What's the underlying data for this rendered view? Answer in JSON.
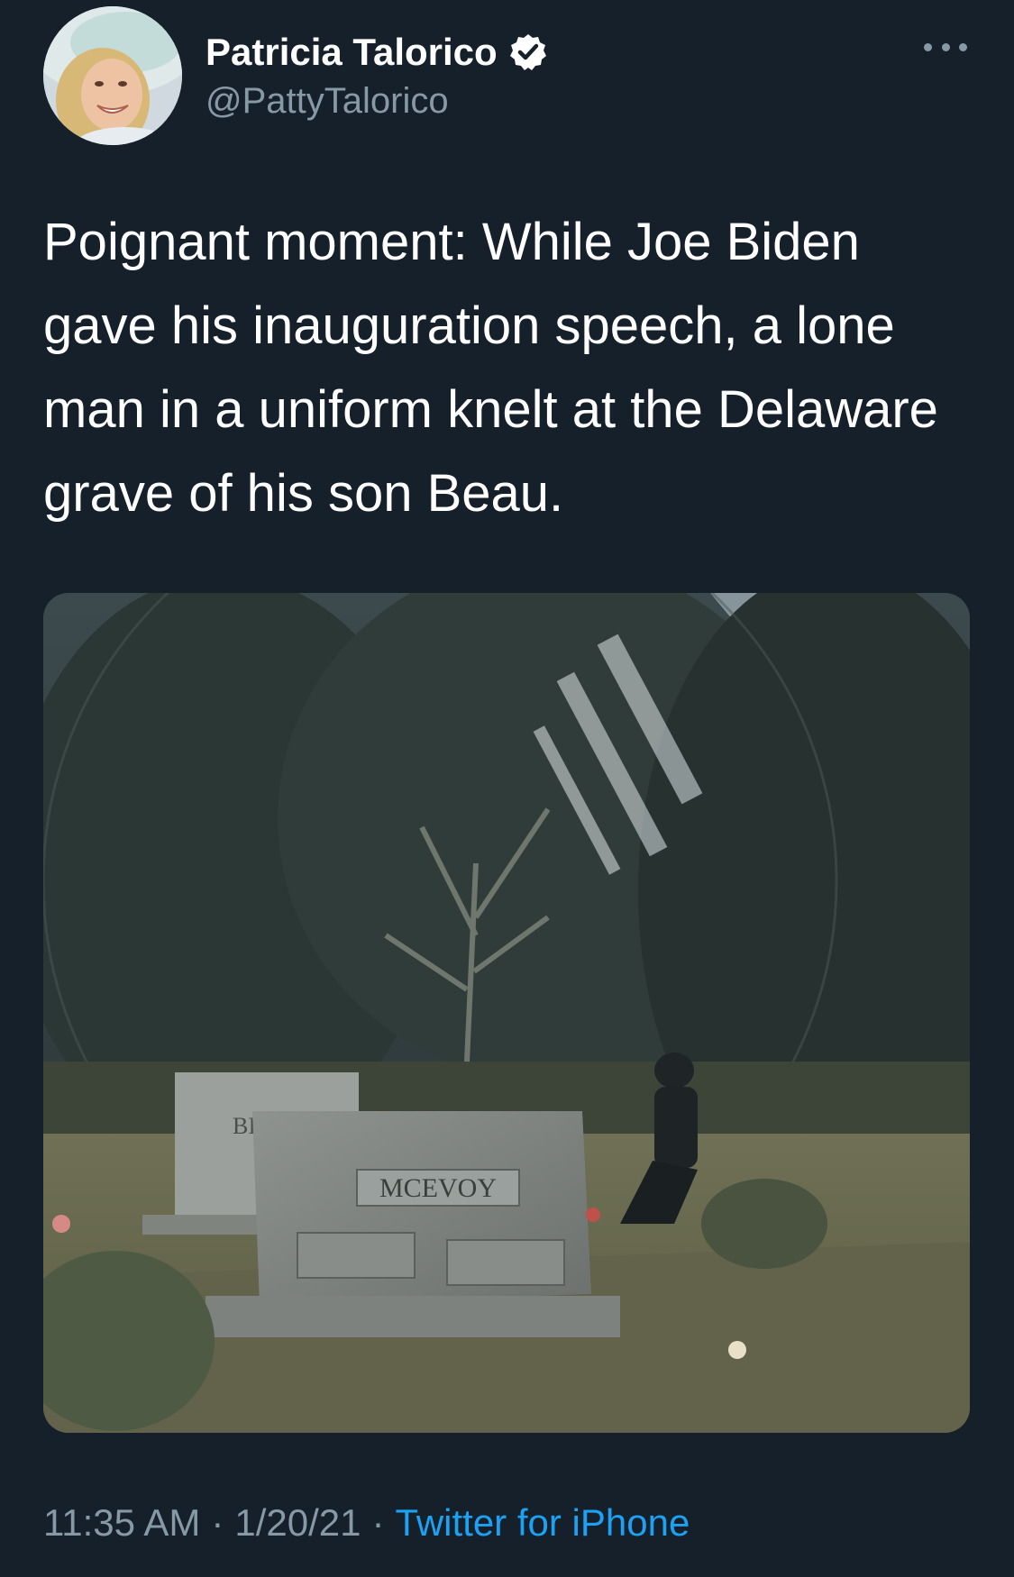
{
  "author": {
    "name": "Patricia Talorico",
    "handle": "@PattyTalorico",
    "verified_icon": "verified-badge-icon",
    "avatar_icon": "profile-photo"
  },
  "menu": {
    "icon": "more-options-icon"
  },
  "tweet": {
    "text": "Poignant moment: While Joe Biden gave his inauguration speech, a lone man in a uniform knelt at the Delaware grave of his son Beau."
  },
  "media": {
    "headstone_front": "MCEVOY",
    "headstone_back_partial": "BI"
  },
  "meta": {
    "time": "11:35 AM",
    "separator": "·",
    "date": "1/20/21",
    "source": "Twitter for iPhone"
  },
  "colors": {
    "background": "#15202b",
    "text_primary": "#ffffff",
    "text_secondary": "#8899a6",
    "link": "#1da1f2"
  }
}
